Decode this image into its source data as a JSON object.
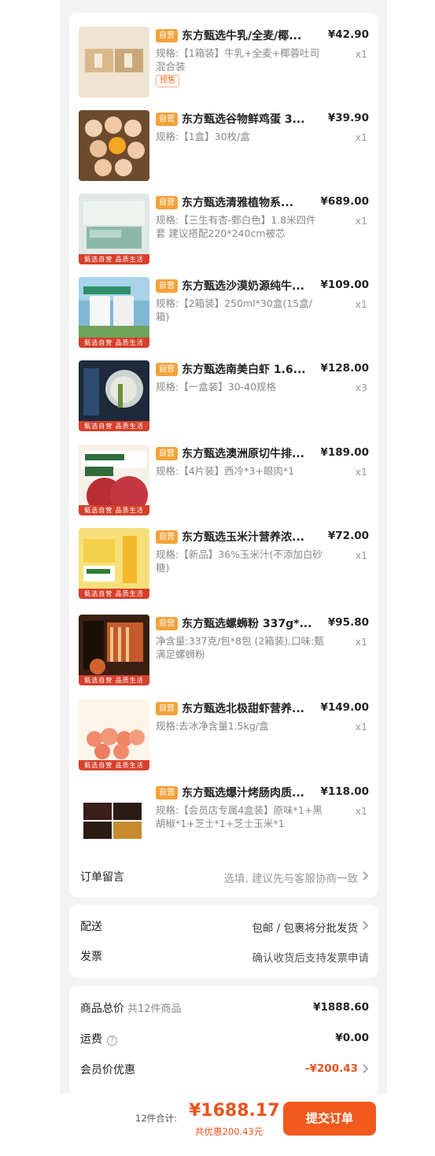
{
  "items": [
    {
      "badge": "自营",
      "title": "东方甄选牛乳/全麦/椰...",
      "price": "¥42.90",
      "spec": "规格:【1箱装】牛乳+全麦+椰蓉吐司混合装",
      "qty": "x1",
      "tag": "预售",
      "icon": "bread-box-image"
    },
    {
      "badge": "自营",
      "title": "东方甄选谷物鲜鸡蛋 3...",
      "price": "¥39.90",
      "spec": "规格:【1盒】30枚/盒",
      "qty": "x1",
      "icon": "eggs-image"
    },
    {
      "badge": "自营",
      "title": "东方甄选清雅植物系...",
      "price": "¥689.00",
      "spec": "规格:【三生有杏-鄄白色】1.8米四件套 建议搭配220*240cm被芯",
      "qty": "x1",
      "strip": "甄选自营  品质生活",
      "icon": "bedding-image"
    },
    {
      "badge": "自营",
      "title": "东方甄选沙漠奶源纯牛...",
      "price": "¥109.00",
      "spec": "规格:【2箱装】250ml*30盒(15盒/箱)",
      "qty": "x1",
      "strip": "甄选自营  品质生活",
      "icon": "milk-box-image"
    },
    {
      "badge": "自营",
      "title": "东方甄选南美白虾 1.6...",
      "price": "¥128.00",
      "spec": "规格:【一盒装】30-40规格",
      "qty": "x3",
      "strip": "甄选自营  品质生活",
      "icon": "shrimp-image"
    },
    {
      "badge": "自营",
      "title": "东方甄选澳洲原切牛排...",
      "price": "¥189.00",
      "spec": "规格:【4片装】西冷*3+眼肉*1",
      "qty": "x1",
      "strip": "甄选自营  品质生活",
      "icon": "steak-image"
    },
    {
      "badge": "自营",
      "title": "东方甄选玉米汁营养浓...",
      "price": "¥72.00",
      "spec": "规格:【新品】36%玉米汁(不添加白砂糖)",
      "qty": "x1",
      "strip": "甄选自营  品质生活",
      "icon": "corn-juice-image"
    },
    {
      "badge": "自营",
      "title": "东方甄选螺蛳粉 337g*...",
      "price": "¥95.80",
      "spec": "净含量:337克/包*8包 (2箱装),口味:甄满足螺蛳粉",
      "qty": "x1",
      "strip": "甄选自营  品质生活",
      "icon": "noodles-image"
    },
    {
      "badge": "自营",
      "title": "东方甄选北极甜虾营养...",
      "price": "¥149.00",
      "spec": "规格:去冰净含量1.5kg/盒",
      "qty": "x1",
      "strip": "甄选自营  品质生活",
      "icon": "sweet-shrimp-image"
    },
    {
      "badge": "自营",
      "title": "东方甄选爆汁烤肠肉质...",
      "price": "¥118.00",
      "spec": "规格:【会员店专属4盒装】原味*1+黑胡椒*1+芝士*1+芝士玉米*1",
      "qty": "x1",
      "icon": "sausage-box-image"
    }
  ],
  "note": {
    "label": "订单留言",
    "value": "选填, 建议先与客服协商一致"
  },
  "delivery": {
    "label": "配送",
    "value": "包邮 / 包裹将分批发货"
  },
  "invoice": {
    "label": "发票",
    "value": "确认收货后支持发票申请"
  },
  "summary": {
    "goods_label": "商品总价",
    "goods_count": "共12件商品",
    "goods_value": "¥1888.60",
    "shipping_label": "运费",
    "shipping_value": "¥0.00",
    "member_label": "会员价优惠",
    "member_value": "-¥200.43"
  },
  "footer": {
    "total_label": "12件合计:",
    "total_amount": "¥1688.17",
    "saved": "共优惠200.43元",
    "submit": "提交订单"
  },
  "colors": {
    "accent": "#f25a1d",
    "badge": "#f2a33a",
    "strip": "#d6402b"
  }
}
